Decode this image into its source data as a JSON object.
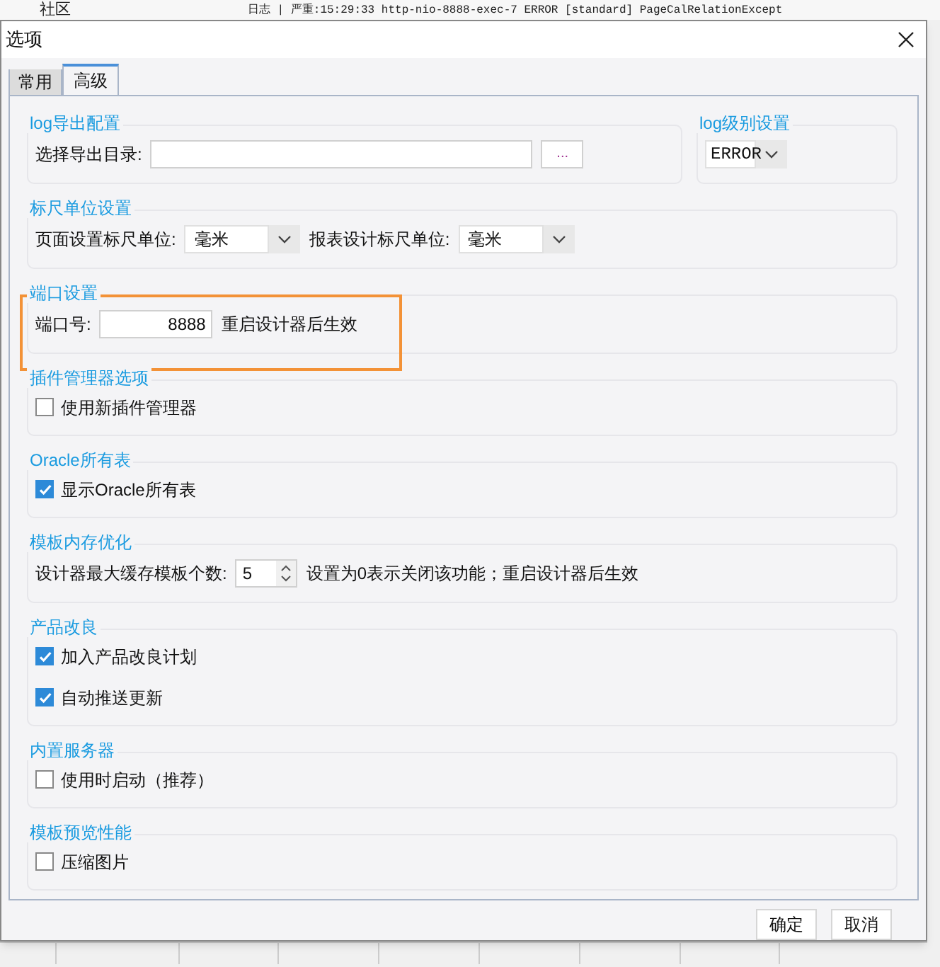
{
  "background": {
    "texts": [
      "社区",
      "日志 | 严重:15:29:33 http-nio-8888-exec-7 ERROR [standard] PageCalRelationExcept"
    ]
  },
  "dialog": {
    "title": "选项"
  },
  "tabs": [
    {
      "label": "常用",
      "selected": false
    },
    {
      "label": "高级",
      "selected": true
    }
  ],
  "sections": [
    {
      "groups": [
        {
          "title": "log导出配置",
          "items": [
            {
              "kind": "label",
              "text": "选择导出目录:"
            },
            {
              "kind": "field",
              "value": "",
              "wide": true
            },
            {
              "kind": "browse",
              "text": "..."
            }
          ]
        },
        {
          "title": "log级别设置",
          "items": [
            {
              "kind": "dropdown",
              "value": "ERROR",
              "mono": true
            }
          ]
        }
      ]
    },
    {
      "groups": [
        {
          "title": "标尺单位设置",
          "items": [
            {
              "kind": "label",
              "text": "页面设置标尺单位:"
            },
            {
              "kind": "dropdown",
              "value": "毫米"
            },
            {
              "kind": "label",
              "text": "报表设计标尺单位:"
            },
            {
              "kind": "dropdown",
              "value": "毫米"
            }
          ]
        }
      ]
    },
    {
      "groups": [
        {
          "title": "端口设置",
          "highlight": true,
          "items": [
            {
              "kind": "label",
              "text": "端口号:"
            },
            {
              "kind": "field",
              "value": "8888"
            },
            {
              "kind": "label",
              "text": "重启设计器后生效"
            }
          ]
        }
      ]
    },
    {
      "groups": [
        {
          "title": "插件管理器选项",
          "items": [
            {
              "kind": "checkbox",
              "text": "使用新插件管理器",
              "checked": false
            }
          ]
        }
      ]
    },
    {
      "groups": [
        {
          "title": "Oracle所有表",
          "items": [
            {
              "kind": "checkbox",
              "text": "显示Oracle所有表",
              "checked": true
            }
          ]
        }
      ]
    },
    {
      "groups": [
        {
          "title": "模板内存优化",
          "items": [
            {
              "kind": "label",
              "text": "设计器最大缓存模板个数:"
            },
            {
              "kind": "spinner",
              "value": "5"
            },
            {
              "kind": "label",
              "text": "设置为0表示关闭该功能；重启设计器后生效"
            }
          ]
        }
      ]
    },
    {
      "groups": [
        {
          "title": "产品改良",
          "items": [
            {
              "kind": "checkbox",
              "text": "加入产品改良计划",
              "checked": true
            },
            {
              "kind": "checkbox",
              "text": "自动推送更新",
              "checked": true
            }
          ]
        }
      ]
    },
    {
      "groups": [
        {
          "title": "内置服务器",
          "items": [
            {
              "kind": "checkbox",
              "text": "使用时启动（推荐）",
              "checked": false
            }
          ]
        }
      ]
    },
    {
      "groups": [
        {
          "title": "模板预览性能",
          "items": [
            {
              "kind": "checkbox",
              "text": "压缩图片",
              "checked": false
            }
          ]
        }
      ]
    }
  ],
  "buttons": [
    "确定",
    "取消"
  ]
}
